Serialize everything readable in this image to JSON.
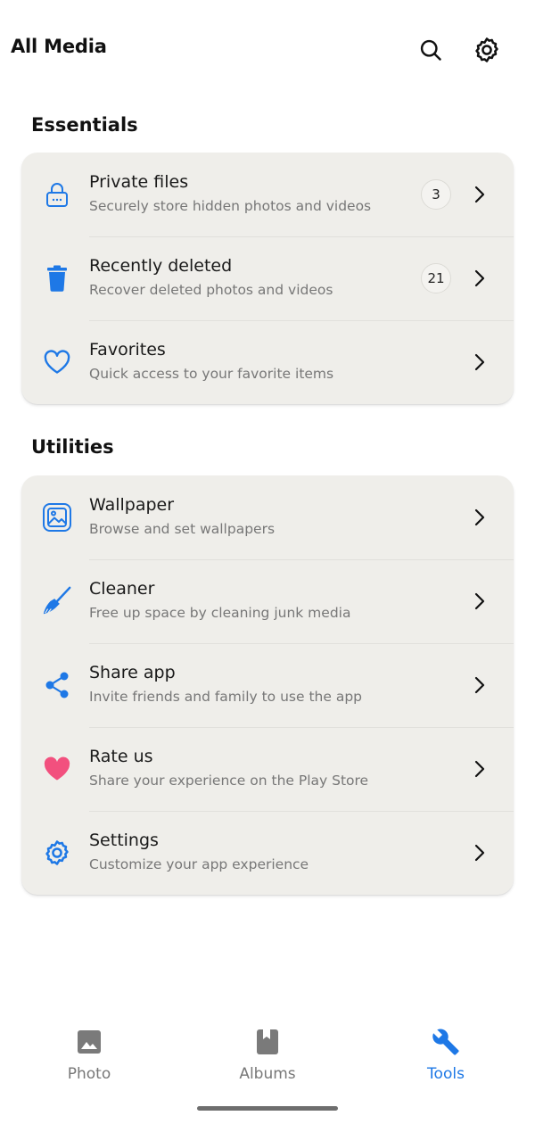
{
  "header": {
    "title": "All Media",
    "search_icon": "search-icon",
    "settings_icon": "gear-icon"
  },
  "sections": [
    {
      "title": "Essentials",
      "items": [
        {
          "title": "Private files",
          "subtitle": "Securely store hidden photos and videos",
          "badge": "3",
          "icon": "lock-icon"
        },
        {
          "title": "Recently deleted",
          "subtitle": "Recover deleted photos and videos",
          "badge": "21",
          "icon": "trash-icon"
        },
        {
          "title": "Favorites",
          "subtitle": "Quick access to your favorite items",
          "badge": "",
          "icon": "heart-outline-icon"
        }
      ]
    },
    {
      "title": "Utilities",
      "items": [
        {
          "title": "Wallpaper",
          "subtitle": "Browse and set wallpapers",
          "icon": "wallpaper-icon"
        },
        {
          "title": "Cleaner",
          "subtitle": "Free up space by cleaning junk media",
          "icon": "broom-icon"
        },
        {
          "title": "Share app",
          "subtitle": "Invite friends and family to use the app",
          "icon": "share-icon"
        },
        {
          "title": "Rate us",
          "subtitle": "Share your experience on the Play Store",
          "icon": "heart-filled-icon"
        },
        {
          "title": "Settings",
          "subtitle": "Customize your app experience",
          "icon": "gear-icon"
        }
      ]
    }
  ],
  "bottom_nav": {
    "items": [
      {
        "label": "Photo",
        "icon": "image-icon",
        "active": false
      },
      {
        "label": "Albums",
        "icon": "album-icon",
        "active": false
      },
      {
        "label": "Tools",
        "icon": "wrench-icon",
        "active": true
      }
    ]
  },
  "colors": {
    "accent": "#1e78e6",
    "heart_pink": "#f2507e",
    "card_bg": "#efeeea",
    "inactive": "#777777"
  }
}
